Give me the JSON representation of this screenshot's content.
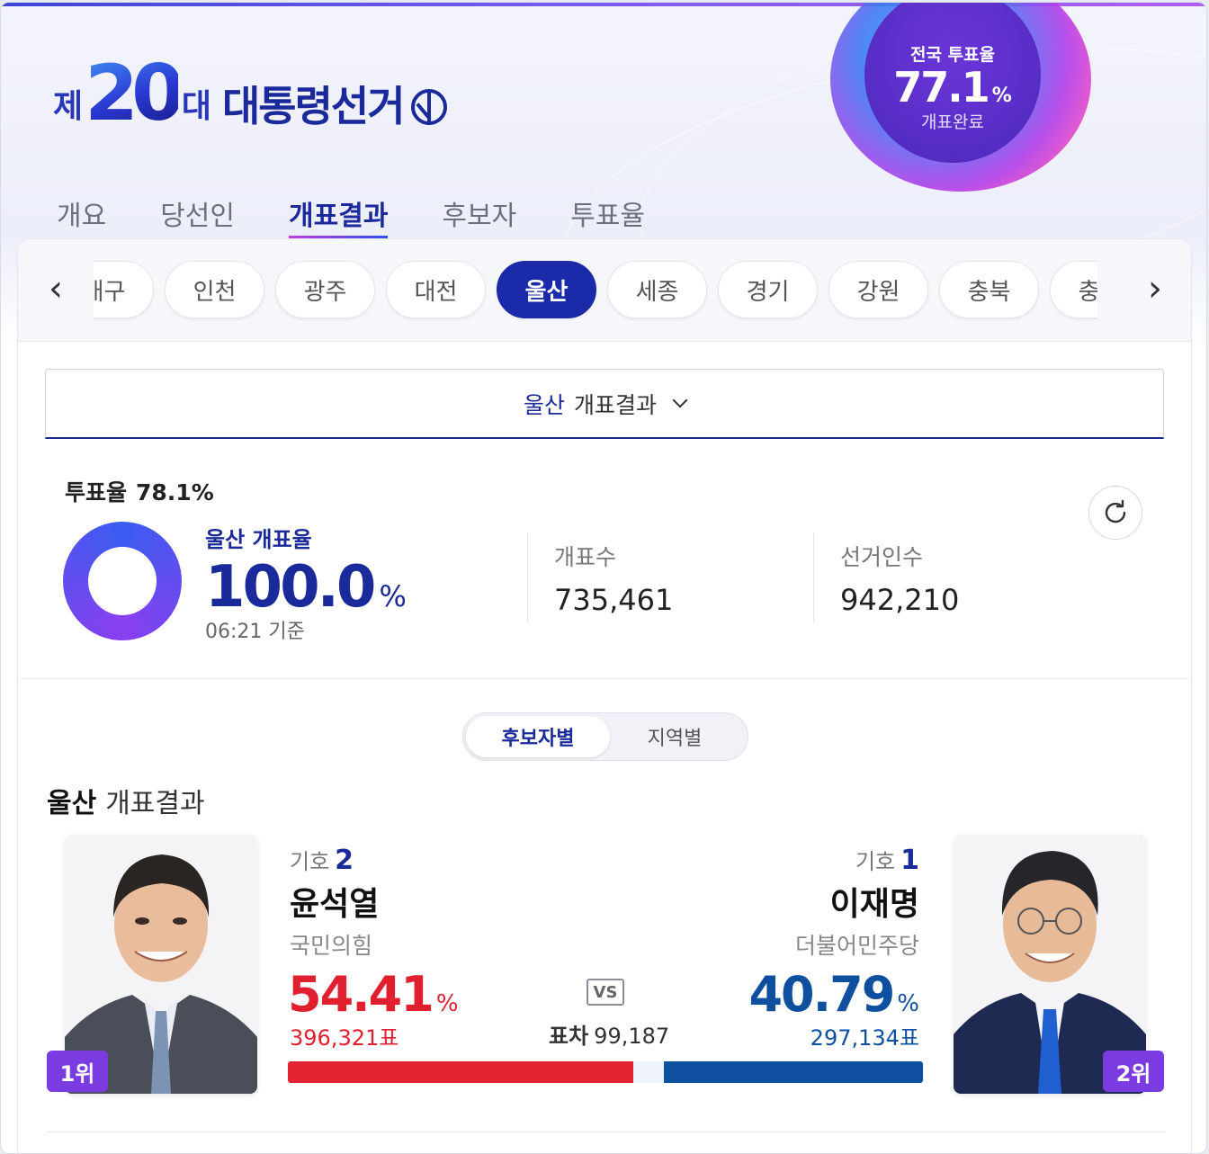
{
  "header": {
    "logo": {
      "prefix": "제",
      "number": "20",
      "suffix": "대",
      "title": "대통령선거"
    },
    "national": {
      "label": "전국 투표율",
      "value": "77.1",
      "unit": "%",
      "status": "개표완료"
    }
  },
  "tabs": [
    "개요",
    "당선인",
    "개표결과",
    "후보자",
    "투표율"
  ],
  "active_tab": "개표결과",
  "regions": [
    "대구",
    "인천",
    "광주",
    "대전",
    "울산",
    "세종",
    "경기",
    "강원",
    "충북",
    "충남"
  ],
  "active_region": "울산",
  "select": {
    "region": "울산",
    "label": "개표결과"
  },
  "turnout": {
    "label": "투표율",
    "value": "78.1%"
  },
  "count": {
    "label": "울산 개표율",
    "value": "100.0",
    "unit": "%",
    "time": "06:21 기준",
    "progress": 1.0
  },
  "stats": [
    {
      "label": "개표수",
      "value": "735,461"
    },
    {
      "label": "선거인수",
      "value": "942,210"
    }
  ],
  "view_toggle": {
    "selected": "후보자별",
    "other": "지역별"
  },
  "result_title": {
    "region": "울산",
    "label": "개표결과"
  },
  "candidates": [
    {
      "symbol_label": "기호",
      "symbol": "2",
      "name": "윤석열",
      "party": "국민의힘",
      "percent": "54.41",
      "votes": "396,321표",
      "rank": "1위",
      "color": "#e3232f",
      "share": 54.41
    },
    {
      "symbol_label": "기호",
      "symbol": "1",
      "name": "이재명",
      "party": "더불어민주당",
      "percent": "40.79",
      "votes": "297,134표",
      "rank": "2위",
      "color": "#0e4fa0",
      "share": 40.79
    }
  ],
  "vs_label": "VS",
  "margin": {
    "label": "표차",
    "value": "99,187"
  },
  "percent_unit": "%"
}
